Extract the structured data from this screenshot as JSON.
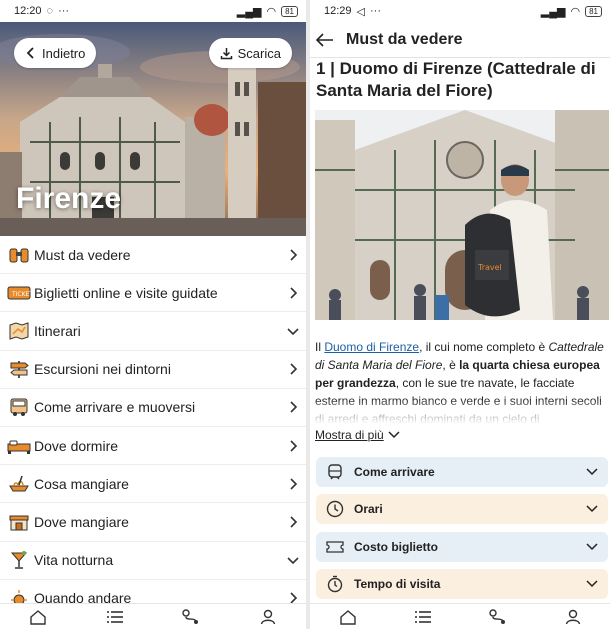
{
  "left": {
    "status": {
      "time": "12:20",
      "battery": "81"
    },
    "hero": {
      "back_label": "Indietro",
      "download_label": "Scarica",
      "city": "Firenze"
    },
    "menu": [
      {
        "label": "Must da vedere",
        "chevron": "right",
        "icon": "binoculars-icon"
      },
      {
        "label": "Biglietti online e visite guidate",
        "chevron": "right",
        "icon": "ticket-icon"
      },
      {
        "label": "Itinerari",
        "chevron": "down",
        "icon": "map-icon"
      },
      {
        "label": "Escursioni nei dintorni",
        "chevron": "right",
        "icon": "signpost-icon"
      },
      {
        "label": "Come arrivare e muoversi",
        "chevron": "right",
        "icon": "bus-icon"
      },
      {
        "label": "Dove dormire",
        "chevron": "right",
        "icon": "bed-icon"
      },
      {
        "label": "Cosa mangiare",
        "chevron": "right",
        "icon": "pasta-icon"
      },
      {
        "label": "Dove mangiare",
        "chevron": "right",
        "icon": "restaurant-icon"
      },
      {
        "label": "Vita notturna",
        "chevron": "down",
        "icon": "cocktail-icon"
      },
      {
        "label": "Quando andare",
        "chevron": "right",
        "icon": "sun-icon"
      }
    ]
  },
  "right": {
    "status": {
      "time": "12:29",
      "battery": "81"
    },
    "title": "Must da vedere",
    "heading": "1 | Duomo di Firenze (Cattedrale di Santa Maria del Fiore)",
    "para": {
      "p1": "Il ",
      "link": "Duomo di Firenze",
      "p2": ", il cui nome completo è ",
      "italic": "Cattedrale di Santa Maria del Fiore",
      "p3": ", è ",
      "bold": "la quarta chiesa europea per grandezza",
      "p4": ", con le sue tre navate, le facciate esterne in marmo bianco e verde e i suoi interni secoli di arredi e affreschi dominati da un cielo di"
    },
    "more_label": "Mostra di più",
    "accordions": [
      {
        "label": "Come arrivare",
        "icon": "train-icon",
        "bg": "#e6eef6"
      },
      {
        "label": "Orari",
        "icon": "clock-icon",
        "bg": "#fbefdf"
      },
      {
        "label": "Costo biglietto",
        "icon": "ticket-icon",
        "bg": "#e6eef6"
      },
      {
        "label": "Tempo di visita",
        "icon": "stopwatch-icon",
        "bg": "#fbefdf"
      }
    ]
  },
  "tabs": [
    "home-icon",
    "list-icon",
    "route-icon",
    "profile-icon"
  ],
  "colors": {
    "accent_orange": "#e88b2b",
    "link_blue": "#1a5fa8"
  }
}
